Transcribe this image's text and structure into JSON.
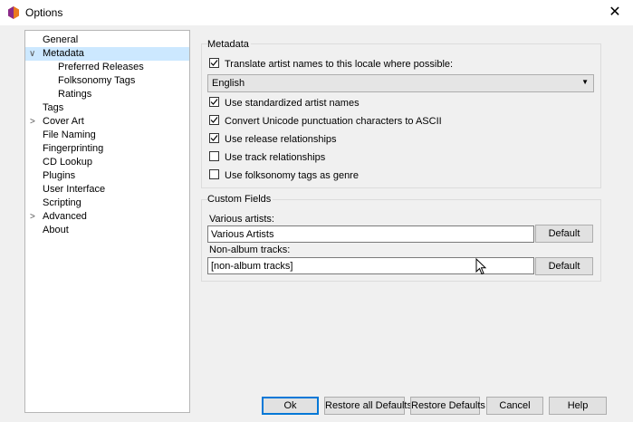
{
  "window": {
    "title": "Options",
    "close_glyph": "✕",
    "app_icon": "picard-logo-icon"
  },
  "sidebar": {
    "items": [
      {
        "label": "General"
      },
      {
        "label": "Metadata",
        "arrow": "∨"
      },
      {
        "label": "Preferred Releases"
      },
      {
        "label": "Folksonomy Tags"
      },
      {
        "label": "Ratings"
      },
      {
        "label": "Tags"
      },
      {
        "label": "Cover Art",
        "arrow": ">"
      },
      {
        "label": "File Naming"
      },
      {
        "label": "Fingerprinting"
      },
      {
        "label": "CD Lookup"
      },
      {
        "label": "Plugins"
      },
      {
        "label": "User Interface"
      },
      {
        "label": "Scripting"
      },
      {
        "label": "Advanced",
        "arrow": ">"
      },
      {
        "label": "About"
      }
    ],
    "selected": "Metadata"
  },
  "metadata_group": {
    "title": "Metadata",
    "translate": {
      "label": "Translate artist names to this locale where possible:",
      "checked": true
    },
    "locale": {
      "value": "English"
    },
    "options": [
      {
        "label": "Use standardized artist names",
        "checked": true
      },
      {
        "label": "Convert Unicode punctuation characters to ASCII",
        "checked": true
      },
      {
        "label": "Use release relationships",
        "checked": true
      },
      {
        "label": "Use track relationships",
        "checked": false
      },
      {
        "label": "Use folksonomy tags as genre",
        "checked": false
      }
    ]
  },
  "custom_fields": {
    "title": "Custom Fields",
    "various_label": "Various artists:",
    "various_value": "Various Artists",
    "nonalbum_label": "Non-album tracks:",
    "nonalbum_value": "[non-album tracks]",
    "default_label": "Default"
  },
  "footer": {
    "ok": "Ok",
    "restore_all": "Restore all Defaults",
    "restore": "Restore Defaults",
    "cancel": "Cancel",
    "help": "Help"
  }
}
